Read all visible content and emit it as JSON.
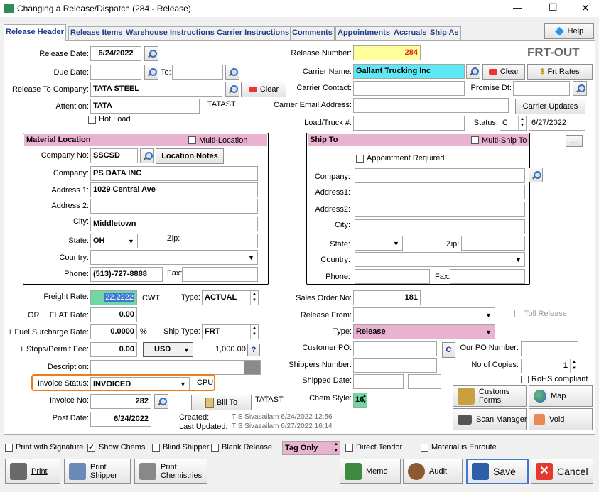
{
  "window": {
    "title": "Changing a Release/Dispatch  (284 - Release)",
    "min": "—",
    "max": "☐",
    "close": "✕"
  },
  "tabs": [
    "Release Header",
    "Release Items",
    "Warehouse Instructions",
    "Carrier Instructions",
    "Comments",
    "Appointments",
    "Accruals",
    "Ship As"
  ],
  "help": "Help",
  "frt_out": "FRT-OUT",
  "labels": {
    "release_date": "Release Date:",
    "due_date": "Due Date:",
    "to": "To:",
    "release_to_company": "Release To Company:",
    "attention": "Attention:",
    "hot_load": "Hot Load",
    "release_number": "Release Number:",
    "carrier_name": "Carrier Name:",
    "carrier_contact": "Carrier Contact:",
    "promise_dt": "Promise Dt:",
    "carrier_email": "Carrier Email Address:",
    "load_truck": "Load/Truck #:",
    "status": "Status:",
    "clear": "Clear",
    "frt_rates": "Frt Rates",
    "carrier_updates": "Carrier Updates"
  },
  "values": {
    "release_date": "6/24/2022",
    "release_to_company": "TATA STEEL",
    "attention": "TATA",
    "tatast": "TATAST",
    "release_number": "284",
    "carrier_name": "Gallant Trucking Inc",
    "status_code": "C",
    "status_date": "6/27/2022"
  },
  "material": {
    "title": "Material Location",
    "multi": "Multi-Location",
    "company_no_lbl": "Company No:",
    "company_no": "SSCSD",
    "location_notes": "Location Notes",
    "company_lbl": "Company:",
    "company": "PS DATA INC",
    "addr1_lbl": "Address 1:",
    "addr1": "1029 Central Ave",
    "addr2_lbl": "Address 2:",
    "city_lbl": "City:",
    "city": "Middletown",
    "state_lbl": "State:",
    "state": "OH",
    "zip_lbl": "Zip:",
    "country_lbl": "Country:",
    "phone_lbl": "Phone:",
    "phone": "(513)-727-8888",
    "fax_lbl": "Fax:"
  },
  "shipto": {
    "title": "Ship To",
    "multi": "Multi-Ship To",
    "more": "...",
    "appt": "Appointment Required",
    "company_lbl": "Company:",
    "addr1_lbl": "Address1:",
    "addr2_lbl": "Address2:",
    "city_lbl": "City:",
    "state_lbl": "State:",
    "zip_lbl": "Zip:",
    "country_lbl": "Country:",
    "phone_lbl": "Phone:",
    "fax_lbl": "Fax:"
  },
  "freight": {
    "rate_lbl": "Freight Rate:",
    "rate": "22.2222",
    "cwt": "CWT",
    "type_lbl": "Type:",
    "type": "ACTUAL",
    "or": "OR",
    "flat_lbl": "FLAT Rate:",
    "flat": "0.00",
    "fuel_lbl": "+ Fuel Surcharge Rate:",
    "fuel": "0.0000",
    "pct": "%",
    "shiptype_lbl": "Ship Type:",
    "shiptype": "FRT",
    "stops_lbl": "+ Stops/Permit Fee:",
    "stops": "0.00",
    "currency": "USD",
    "rate_amt": "1,000.00",
    "q": "?",
    "desc_lbl": "Description:",
    "inv_status_lbl": "Invoice Status:",
    "inv_status": "INVOICED",
    "cpu": "CPU",
    "inv_no_lbl": "Invoice No:",
    "inv_no": "282",
    "bill_to": "Bill To",
    "tatast": "TATAST",
    "post_lbl": "Post Date:",
    "post": "6/24/2022",
    "created_lbl": "Created:",
    "created": "T S Sivasailam 6/24/2022 12:56",
    "updated_lbl": "Last Updated:",
    "updated": "T S Sivasailam 6/27/2022 16:14"
  },
  "sales": {
    "so_lbl": "Sales Order No:",
    "so": "181",
    "from_lbl": "Release From:",
    "toll": "Toll Release",
    "type_lbl": "Type:",
    "type": "Release",
    "cpo_lbl": "Customer PO:",
    "c": "C",
    "our_po_lbl": "Our PO Number:",
    "shippers_lbl": "Shippers Number:",
    "copies_lbl": "No of Copies:",
    "copies": "1",
    "shipped_lbl": "Shipped Date:",
    "rohs": "RoHS compliant",
    "chem_lbl": "Chem Style:",
    "chem": "16"
  },
  "actions": {
    "customs": "Customs Forms",
    "map": "Map",
    "scan": "Scan Manager",
    "void": "Void"
  },
  "checks": {
    "print_sig": "Print with Signature",
    "show_chems": "Show Chems",
    "blind": "Blind Shipper",
    "blank": "Blank Release",
    "tag_only": "Tag Only",
    "direct": "Direct Tendor",
    "enroute": "Material is Enroute"
  },
  "bottom": {
    "print": "Print",
    "print_shipper": "Print Shipper",
    "print_chem": "Print Chemistries",
    "memo": "Memo",
    "audit": "Audit",
    "save": "Save",
    "cancel": "Cancel"
  },
  "colors": {
    "yellow": "#ffff99",
    "cyan": "#5ce8f4",
    "pink": "#e8b2d0",
    "green": "#6ed8a0",
    "orange": "#f07c16"
  }
}
